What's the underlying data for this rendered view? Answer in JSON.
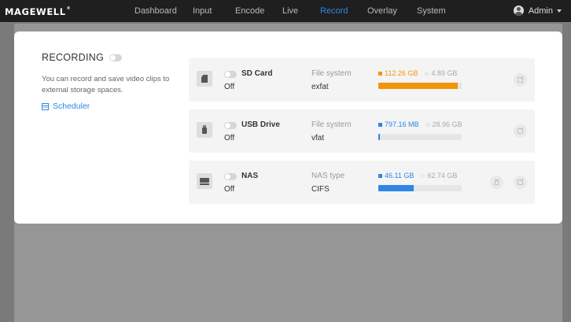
{
  "nav": {
    "logo": "MAGEWELL",
    "logo_mark": "®",
    "items": [
      {
        "label": "Dashboard"
      },
      {
        "label": "Input"
      },
      {
        "label": "Encode"
      },
      {
        "label": "Live"
      },
      {
        "label": "Record",
        "active": true
      },
      {
        "label": "Overlay"
      },
      {
        "label": "System"
      }
    ],
    "user": "Admin"
  },
  "recording": {
    "title": "RECORDING",
    "enabled": false,
    "description": "You can record and save video clips to external storage spaces.",
    "scheduler_label": "Scheduler"
  },
  "storages": [
    {
      "name": "SD Card",
      "state": "Off",
      "fs_label": "File system",
      "fs_value": "exfat",
      "used": "112.26 GB",
      "total": "4.89 GB",
      "used_fraction": 0.95,
      "color": "#f0960a",
      "icon": "sd-card-icon"
    },
    {
      "name": "USB Drive",
      "state": "Off",
      "fs_label": "File system",
      "fs_value": "vfat",
      "used": "797.16 MB",
      "total": "28.96 GB",
      "used_fraction": 0.02,
      "color": "#2f86e6",
      "icon": "usb-drive-icon"
    },
    {
      "name": "NAS",
      "state": "Off",
      "fs_label": "NAS type",
      "fs_value": "CIFS",
      "used": "46.11 GB",
      "total": "62.74 GB",
      "used_fraction": 0.42,
      "color": "#2f86e6",
      "icon": "nas-icon"
    }
  ],
  "colors": {
    "accent": "#2f86e6",
    "warning": "#f0960a",
    "nav_bg": "#1f1f1f"
  }
}
